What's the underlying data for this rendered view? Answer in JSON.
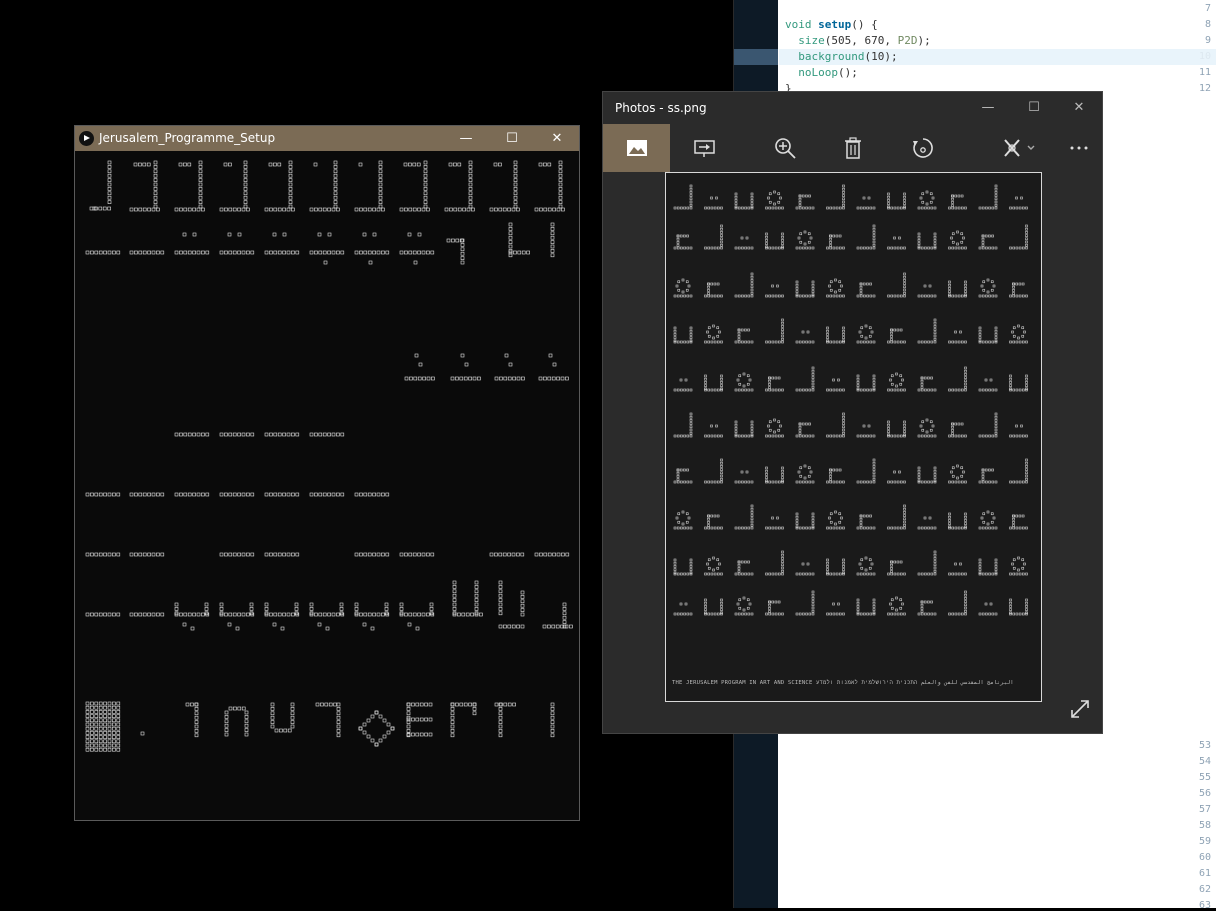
{
  "editor": {
    "lines": [
      {
        "n": "7",
        "text": ""
      },
      {
        "n": "8",
        "text": "void setup() {"
      },
      {
        "n": "9",
        "text": "  size(505, 670, P2D);"
      },
      {
        "n": "10",
        "text": "  background(10);"
      },
      {
        "n": "11",
        "text": "  noLoop();"
      },
      {
        "n": "12",
        "text": "}"
      }
    ],
    "lower_line_numbers": [
      "53",
      "54",
      "55",
      "56",
      "57",
      "58",
      "59",
      "60",
      "61",
      "62",
      "63"
    ],
    "current_line": "10"
  },
  "sketch_window": {
    "title": "Jerusalem_Programme_Setup",
    "minimize": "—",
    "maximize": "☐",
    "close": "✕"
  },
  "photos_window": {
    "title": "Photos - ss.png",
    "minimize": "—",
    "maximize": "☐",
    "close": "✕",
    "toolbar": [
      {
        "name": "image-view-icon",
        "label": "View"
      },
      {
        "name": "slideshow-icon",
        "label": "Slideshow"
      },
      {
        "name": "zoom-icon",
        "label": "Zoom"
      },
      {
        "name": "delete-icon",
        "label": "Delete"
      },
      {
        "name": "rotate-icon",
        "label": "Rotate"
      },
      {
        "name": "edit-icon",
        "label": "Edit & Create"
      },
      {
        "name": "more-icon",
        "label": "See more"
      }
    ],
    "photo_caption": "THE JERUSALEM PROGRAM IN ART AND SCIENCE   البرنامج المقدسي للفن والعلم   התכנית הירושלמית לאמנות ולמדע"
  },
  "colors": {
    "accent": "#7b6b55",
    "sketch_bg": "#0a0a0a",
    "photos_bg": "#2b2b2b"
  }
}
